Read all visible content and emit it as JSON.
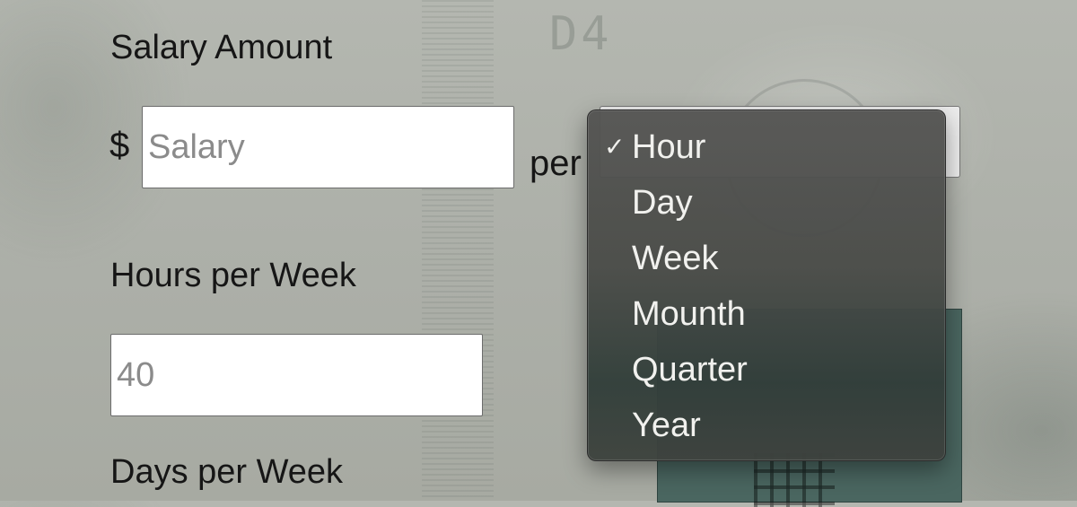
{
  "form": {
    "salary_label": "Salary Amount",
    "currency_symbol": "$",
    "salary_placeholder": "Salary",
    "per_label": "per",
    "hours_label": "Hours per Week",
    "hours_placeholder": "40",
    "days_label": "Days per Week"
  },
  "period_select": {
    "selected": "Hour",
    "options": [
      {
        "label": "Hour",
        "checked": true
      },
      {
        "label": "Day",
        "checked": false
      },
      {
        "label": "Week",
        "checked": false
      },
      {
        "label": "Mounth",
        "checked": false
      },
      {
        "label": "Quarter",
        "checked": false
      },
      {
        "label": "Year",
        "checked": false
      }
    ],
    "check_icon": "checkmark-icon"
  },
  "background": {
    "serial_fragment": "D4"
  },
  "colors": {
    "page_background": "#b0b3ac",
    "menu_background": "#4e504d",
    "menu_text": "#f1f1ee",
    "teal_panel": "#4a6660"
  }
}
